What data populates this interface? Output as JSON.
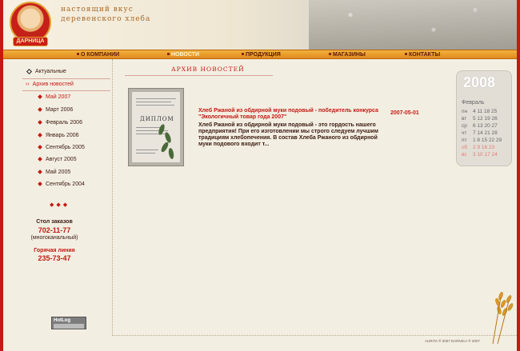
{
  "header": {
    "tagline_line1": "настоящий вкус",
    "tagline_line2": "деревенского хлеба",
    "logo_text": "ДАРНИЦА"
  },
  "nav": [
    {
      "label": "О КОМПАНИИ",
      "active": false
    },
    {
      "label": "НОВОСТИ",
      "active": true
    },
    {
      "label": "ПРОДУКЦИЯ",
      "active": false
    },
    {
      "label": "МАГАЗИНЫ",
      "active": false
    },
    {
      "label": "КОНТАКТЫ",
      "active": false
    }
  ],
  "sidebar": {
    "actual": "Актуальные",
    "archive": "Архив новостей",
    "months": [
      "Май 2007",
      "Март 2006",
      "Февраль 2006",
      "Январь 2006",
      "Сентябрь 2005",
      "Август 2005",
      "Май 2005",
      "Сентябрь 2004"
    ],
    "order_label": "Стол заказов",
    "order_number": "702-11-77",
    "order_note": "(многоканальный)",
    "hotline_label": "Горячая линия",
    "hotline_number": "235-73-47",
    "counter_text": "HotLog"
  },
  "main": {
    "section_title": "АРХИВ НОВОСТЕЙ",
    "diploma_title": "ДИПЛОМ",
    "news": {
      "date": "2007-05-01",
      "title": "Хлеб Ржаной из обдирной муки подовый - победитель конкурса \"Экологичный товар года 2007\"",
      "text": "Хлеб Ржаной из обдирной муки подовый - это гордость нашего предприятия! При его изготовлении мы строго следуем лучшим традициям хлебопечения. В состав Хлеба Ржаного из обдирной муки подового входит т..."
    }
  },
  "calendar": {
    "year": "2008",
    "month": "Февраль",
    "rows": [
      {
        "day": "пн",
        "nums": "4 11 18 25",
        "weekend": false
      },
      {
        "day": "вт",
        "nums": "5 12 19 26",
        "weekend": false
      },
      {
        "day": "ср",
        "nums": "6 13 20 27",
        "weekend": false
      },
      {
        "day": "чт",
        "nums": "7 14 21 28",
        "weekend": false
      },
      {
        "day": "пт",
        "nums": "1  8 15 22 29",
        "weekend": false
      },
      {
        "day": "сб",
        "nums": "2  9 16 23",
        "weekend": true
      },
      {
        "day": "вс",
        "nums": "3 10 17 24",
        "weekend": true
      }
    ]
  },
  "footer": {
    "text": "AURITA ® 2007 DARNICA ® 2007"
  },
  "colors": {
    "accent": "#c41a12",
    "nav": "#e9a030",
    "background": "#f3eee2"
  }
}
